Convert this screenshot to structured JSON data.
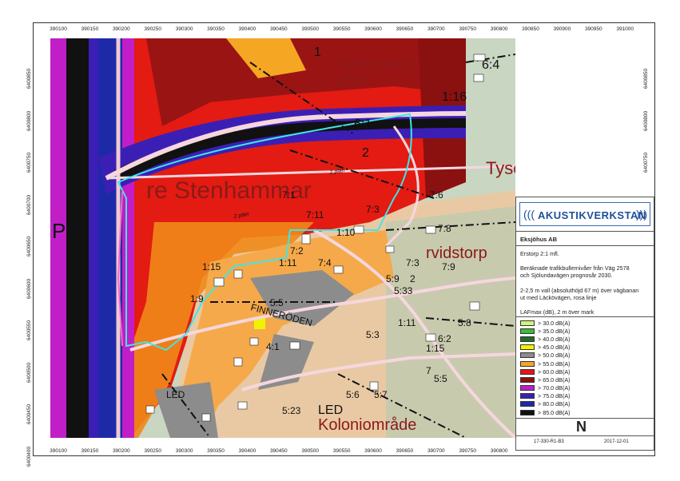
{
  "axes": {
    "x_ticks": [
      "390100",
      "390150",
      "390200",
      "390250",
      "390300",
      "390350",
      "390400",
      "390450",
      "390500",
      "390550",
      "390600",
      "390650",
      "390700",
      "390750",
      "390800",
      "390850",
      "390900",
      "390950",
      "391000"
    ],
    "y_ticks": [
      "6400850",
      "6400800",
      "6400750",
      "6400700",
      "6400650",
      "6400600",
      "6400550",
      "6400500",
      "6400450",
      "6400400"
    ]
  },
  "map_labels": {
    "gronelund": "Grönelund",
    "led1": "LED",
    "stenhammar": "re Stenhammar",
    "arvidstorp": "rvidstorp",
    "finnerodden": "FINNERÖDEN",
    "koloni": "Koloniområde",
    "led2": "LED",
    "led3": "LED",
    "p": "P",
    "tyset": "Tyse",
    "plan": "2 plan",
    "plan2": "2 plan"
  },
  "parcel_labels": [
    "1",
    "6:4",
    "1:16",
    "6:1",
    "2",
    "7:1",
    "7:6",
    "7:11",
    "7:3",
    "7:8",
    "1:10",
    "7:2",
    "7:4",
    "7:3",
    "7:9",
    "1:11",
    "2",
    "5:9",
    "1:15",
    "5:33",
    "1:9",
    "5:5",
    "5:8",
    "1:11",
    "5:3",
    "6:2",
    "1:15",
    "4:1",
    "7",
    "5:6",
    "5:7",
    "5:23",
    "5:5"
  ],
  "legend": {
    "logo": "AKUSTIKVERKSTAN",
    "client": "Eksjöhus AB",
    "project": "Erstorp 2:1 mfl.",
    "desc1": "Beräknade trafikbullernivåer från Väg 2578",
    "desc2": "och Sjölundavägen prognosår 2030.",
    "desc3": "2-2,5 m vall (absoluthöjd 67 m) över vägbanan",
    "desc4": "ut med Läckövägen, rosa linje",
    "metric": "LAFmax (dB), 2 m över mark",
    "items": [
      {
        "label": "> 30.0 dB(A)",
        "color": "#d4f07a"
      },
      {
        "label": "> 35.0 dB(A)",
        "color": "#3fb83f"
      },
      {
        "label": "> 40.0 dB(A)",
        "color": "#1e6b2c"
      },
      {
        "label": "> 45.0 dB(A)",
        "color": "#f2f200"
      },
      {
        "label": "> 50.0 dB(A)",
        "color": "#8c8c8c"
      },
      {
        "label": "> 55.0 dB(A)",
        "color": "#f5a623"
      },
      {
        "label": "> 60.0 dB(A)",
        "color": "#ee1111"
      },
      {
        "label": "> 65.0 dB(A)",
        "color": "#8b1010"
      },
      {
        "label": "> 70.0 dB(A)",
        "color": "#c21ec7"
      },
      {
        "label": "> 75.0 dB(A)",
        "color": "#3b1fb5"
      },
      {
        "label": "> 80.0 dB(A)",
        "color": "#1d2aa8"
      },
      {
        "label": "> 85.0 dB(A)",
        "color": "#111111"
      }
    ],
    "north": "N",
    "ref": "17-330-R1-B3",
    "date": "2017-12-01"
  }
}
